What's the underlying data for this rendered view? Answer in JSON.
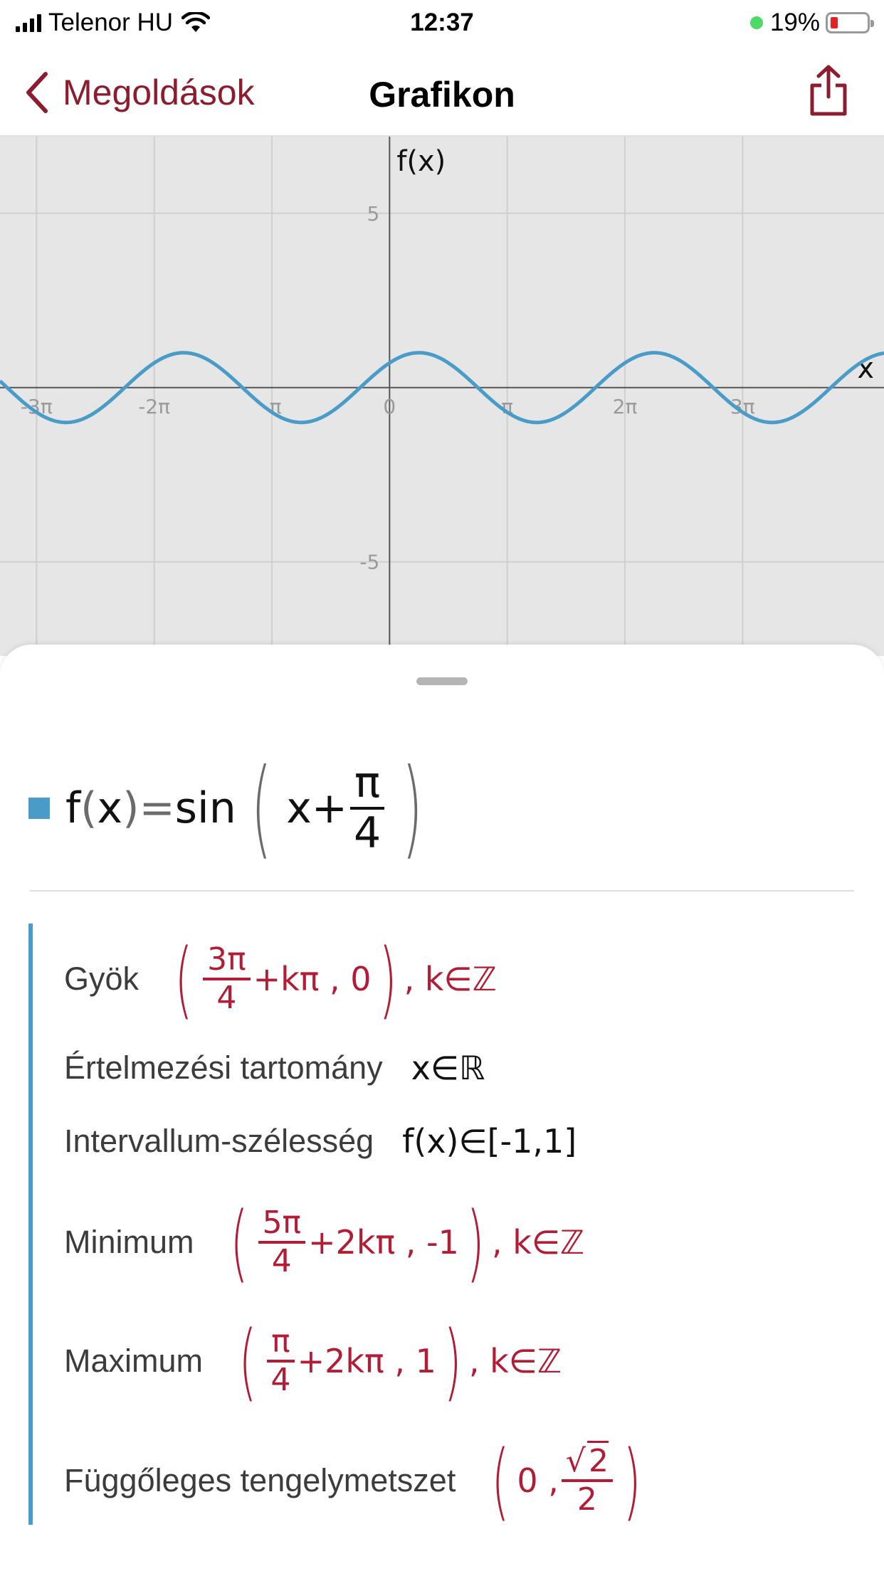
{
  "status_bar": {
    "carrier": "Telenor HU",
    "time": "12:37",
    "battery": "19%",
    "battery_level": 0.19
  },
  "nav": {
    "back_label": "Megoldások",
    "title": "Grafikon",
    "share_icon": "share-icon"
  },
  "chart_data": {
    "type": "line",
    "series": [
      {
        "name": "f(x)=sin(x+π/4)",
        "color": "#4a9cc8",
        "function": "sin(x + pi/4)"
      }
    ],
    "xlabel": "x",
    "ylabel": "f(x)",
    "x_tick_labels": [
      "-3π",
      "-2π",
      "-π",
      "0",
      "π",
      "2π",
      "3π"
    ],
    "y_tick_labels": [
      "5",
      "-5"
    ],
    "xlim": [
      -10.4,
      13.2
    ],
    "ylim": [
      -7.7,
      7.2
    ],
    "grid": true
  },
  "function": {
    "name": "f",
    "var": "x",
    "equals": "=",
    "fn": "sin",
    "inner": "x+",
    "frac_num": "π",
    "frac_den": "4",
    "swatch_color": "#4a9cc8"
  },
  "properties": {
    "roots": {
      "label": "Gyök",
      "num": "3π",
      "den": "4",
      "rest": "+kπ , 0",
      "suffix": ", k∈ℤ"
    },
    "domain": {
      "label": "Értelmezési tartomány",
      "value": "x∈ℝ"
    },
    "range": {
      "label": "Intervallum-szélesség",
      "value": "f(x)∈[-1,1]"
    },
    "minimum": {
      "label": "Minimum",
      "num": "5π",
      "den": "4",
      "rest": "+2kπ , -1",
      "suffix": ", k∈ℤ"
    },
    "maximum": {
      "label": "Maximum",
      "num": "π",
      "den": "4",
      "rest": "+2kπ , 1",
      "suffix": ", k∈ℤ"
    },
    "y_intercept": {
      "label": "Függőleges tengelymetszet",
      "prefix": "0 ,",
      "num": "2",
      "den": "2"
    }
  }
}
